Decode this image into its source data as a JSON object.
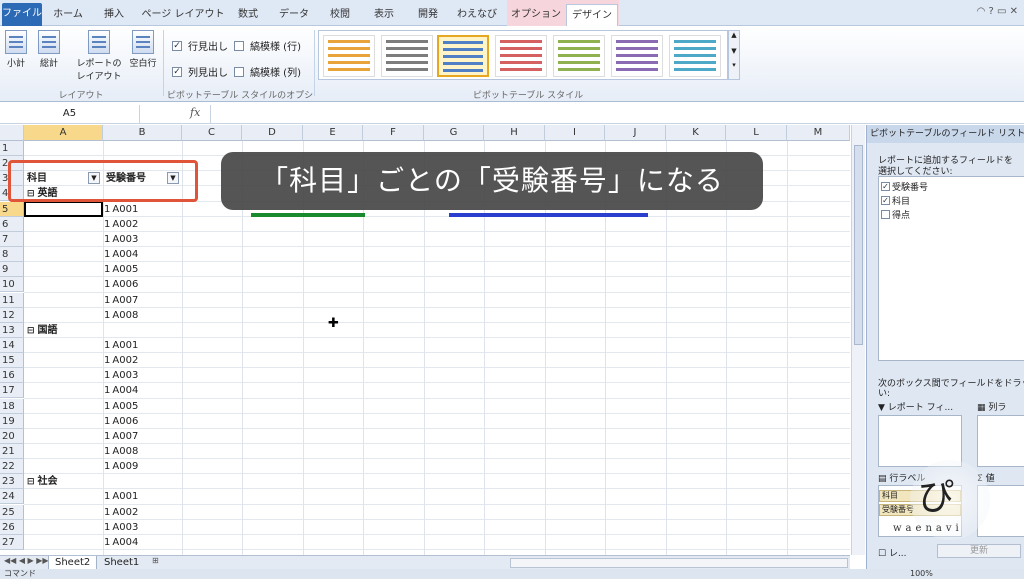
{
  "ribbon_tabs": [
    "ファイル",
    "ホーム",
    "挿入",
    "ページ レイアウト",
    "数式",
    "データ",
    "校閲",
    "表示",
    "開発",
    "わえなび",
    "オプション",
    "デザイン"
  ],
  "ribbon": {
    "layout_buttons": [
      "小計",
      "総計",
      "レポートの\nレイアウト",
      "空白行"
    ],
    "layout_group_label": "レイアウト",
    "options": [
      {
        "label": "行見出し",
        "checked": true
      },
      {
        "label": "縞模様 (行)",
        "checked": false
      },
      {
        "label": "列見出し",
        "checked": true
      },
      {
        "label": "縞模様 (列)",
        "checked": false
      }
    ],
    "options_group_label": "ピボットテーブル スタイルのオプション",
    "styles_group_label": "ピボットテーブル スタイル",
    "swatch_colors": [
      "#e8a33a",
      "#7d7d7d",
      "#4f7fc4",
      "#d46060",
      "#8fb150",
      "#8a6bb3",
      "#4ea8c8"
    ]
  },
  "formula_bar": {
    "name_box": "A5",
    "fx": "fx",
    "formula": ""
  },
  "columns": [
    "A",
    "B",
    "C",
    "D",
    "E",
    "F",
    "G",
    "H",
    "I",
    "J",
    "K",
    "L",
    "M"
  ],
  "rows": [
    "1",
    "2",
    "3",
    "4",
    "5",
    "6",
    "7",
    "8",
    "9",
    "10",
    "11",
    "12",
    "13",
    "14",
    "15",
    "16",
    "17",
    "18",
    "19",
    "20",
    "21",
    "22",
    "23",
    "24",
    "25",
    "26",
    "27"
  ],
  "pivot": {
    "header_a": "科目",
    "header_b": "受験番号",
    "groups": [
      {
        "name": "英語",
        "items": [
          [
            "1",
            "A001"
          ],
          [
            "1",
            "A002"
          ],
          [
            "1",
            "A003"
          ],
          [
            "1",
            "A004"
          ],
          [
            "1",
            "A005"
          ],
          [
            "1",
            "A006"
          ],
          [
            "1",
            "A007"
          ],
          [
            "1",
            "A008"
          ]
        ]
      },
      {
        "name": "国語",
        "items": [
          [
            "1",
            "A001"
          ],
          [
            "1",
            "A002"
          ],
          [
            "1",
            "A003"
          ],
          [
            "1",
            "A004"
          ],
          [
            "1",
            "A005"
          ],
          [
            "1",
            "A006"
          ],
          [
            "1",
            "A007"
          ],
          [
            "1",
            "A008"
          ],
          [
            "1",
            "A009"
          ]
        ]
      },
      {
        "name": "社会",
        "items": [
          [
            "1",
            "A001"
          ],
          [
            "1",
            "A002"
          ],
          [
            "1",
            "A003"
          ],
          [
            "1",
            "A004"
          ]
        ]
      }
    ]
  },
  "caption": "「科目」ごとの「受験番号」になる",
  "sheet_tabs": [
    "Sheet2",
    "Sheet1"
  ],
  "status_text": "コマンド",
  "zoom": "100%",
  "field_panel": {
    "title": "ピボットテーブルのフィールド リスト",
    "instruction_1": "レポートに追加するフィールドを",
    "instruction_2": "選択してください:",
    "fields": [
      {
        "label": "受験番号",
        "checked": true
      },
      {
        "label": "科目",
        "checked": true
      },
      {
        "label": "得点",
        "checked": false
      }
    ],
    "drag_text_1": "次のボックス間でフィールドをドラッグし",
    "drag_text_2": "い:",
    "area_filter": "レポート フィ...",
    "area_column": "列ラ",
    "area_row": "行ラベル",
    "area_values": "値",
    "row_fields": [
      "科目",
      "受験番号"
    ],
    "defer_label": "レ...",
    "update_label": "更新",
    "logo_text": "waenavi"
  }
}
